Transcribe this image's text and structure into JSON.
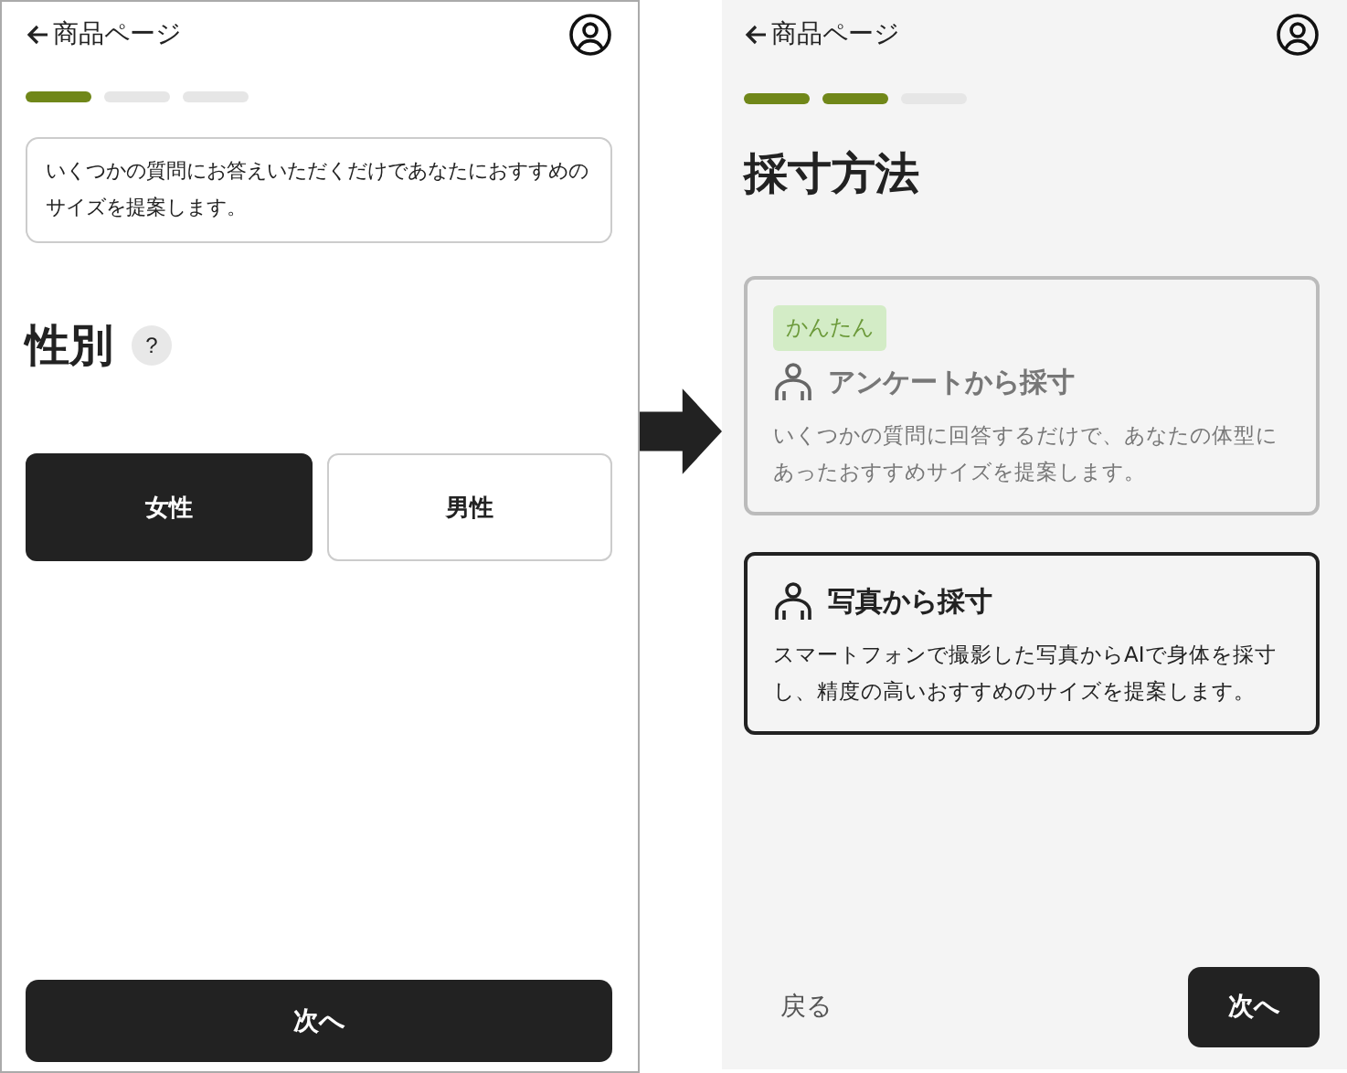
{
  "screens": [
    {
      "back_link": "商品ページ",
      "progress": [
        {
          "filled": true
        },
        {
          "filled": false
        },
        {
          "filled": false
        }
      ],
      "notice": "いくつかの質問にお答えいただくだけであなたにおすすめのサイズを提案します。",
      "title": "性別",
      "help": "?",
      "options": [
        {
          "label": "女性",
          "selected": true
        },
        {
          "label": "男性",
          "selected": false
        }
      ],
      "next_button": "次へ"
    },
    {
      "back_link": "商品ページ",
      "progress": [
        {
          "filled": true
        },
        {
          "filled": true
        },
        {
          "filled": false
        }
      ],
      "title": "採寸方法",
      "cards": [
        {
          "badge": "かんたん",
          "title": "アンケートから採寸",
          "description": "いくつかの質問に回答するだけで、あなたの体型にあったおすすめサイズを提案します。",
          "selected": false
        },
        {
          "title": "写真から採寸",
          "description": "スマートフォンで撮影した写真からAIで身体を採寸し、精度の高いおすすめのサイズを提案します。",
          "selected": true
        }
      ],
      "back_button": "戻る",
      "next_button": "次へ"
    }
  ]
}
